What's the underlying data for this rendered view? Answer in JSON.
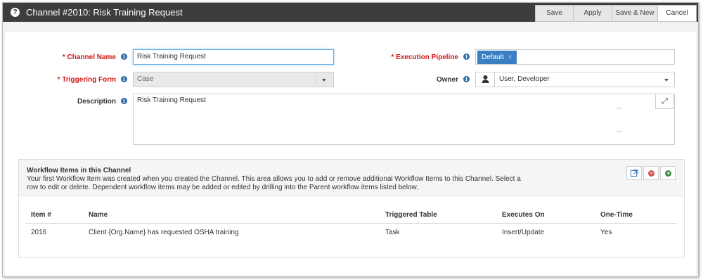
{
  "window": {
    "title": "Channel #2010: Risk Training Request",
    "buttons": {
      "save": "Save",
      "apply": "Apply",
      "save_new": "Save & New",
      "cancel": "Cancel"
    }
  },
  "form": {
    "channel_name": {
      "label": "* Channel Name",
      "value": "Risk Training Request"
    },
    "triggering_form": {
      "label": "* Triggering Form",
      "value": "Case"
    },
    "description": {
      "label": "Description",
      "value": "Risk Training Request"
    },
    "execution_pipeline": {
      "label": "* Execution Pipeline",
      "tag": "Default",
      "tag_remove": "×"
    },
    "owner": {
      "label": "Owner",
      "value": "User, Developer"
    }
  },
  "workflow": {
    "title": "Workflow Items in this Channel",
    "description": "Your first Workflow Item was created when you created the Channel. This area allows you to add or remove additional Workflow Items to this Channel. Select a row to edit or delete. Dependent workflow items may be added or edited by drilling into the Parent workflow items listed below.",
    "columns": [
      "Item #",
      "Name",
      "Triggered Table",
      "Executes On",
      "One-Time"
    ],
    "rows": [
      [
        "2016",
        "Client {Org.Name} has requested OSHA training",
        "Task",
        "Insert/Update",
        "Yes"
      ]
    ]
  },
  "icons": {
    "help": "question-circle-icon",
    "info": "info-circle-icon",
    "owner": "user-icon",
    "expand": "expand-arrows-icon",
    "open": "external-link-icon",
    "remove": "minus-circle-icon",
    "add": "plus-circle-icon"
  },
  "colors": {
    "titlebar": "#3d3d3d",
    "required_label": "#d01818",
    "tag": "#3a7ec4",
    "info_icon": "#2e6fa8",
    "remove_icon": "#d9534f",
    "add_icon": "#3c8c3c"
  }
}
